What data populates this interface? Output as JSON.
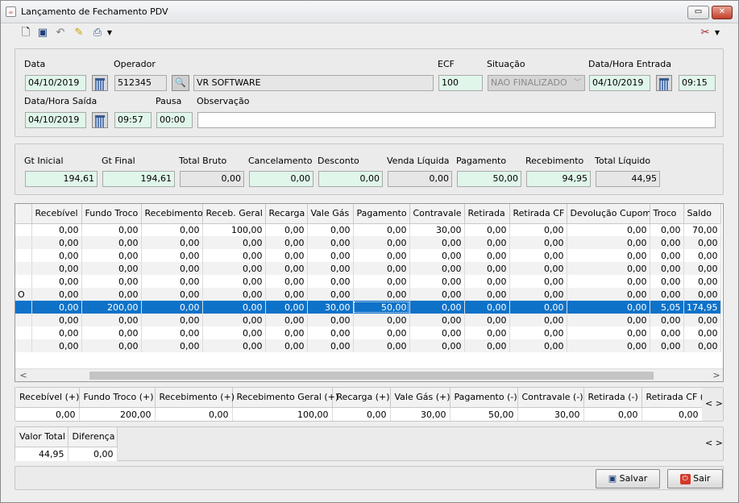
{
  "window": {
    "title": "Lançamento de Fechamento PDV"
  },
  "toolbar": {
    "icons": [
      "new-document-icon",
      "save-icon",
      "undo-icon",
      "magic-wand-icon",
      "print-icon",
      "tools-icon"
    ]
  },
  "header": {
    "data_label": "Data",
    "data_value": "04/10/2019",
    "operador_label": "Operador",
    "operador_code": "512345",
    "operador_name": "VR SOFTWARE",
    "ecf_label": "ECF",
    "ecf_value": "100",
    "situacao_label": "Situação",
    "situacao_value": "NAO FINALIZADO",
    "entrada_label": "Data/Hora Entrada",
    "entrada_date": "04/10/2019",
    "entrada_time": "09:15",
    "saida_label": "Data/Hora Saída",
    "saida_date": "04/10/2019",
    "saida_time": "09:57",
    "pausa_label": "Pausa",
    "pausa_value": "00:00",
    "observacao_label": "Observação",
    "observacao_value": ""
  },
  "totals": [
    {
      "label": "Gt Inicial",
      "value": "194,61"
    },
    {
      "label": "Gt Final",
      "value": "194,61"
    },
    {
      "label": "Total Bruto",
      "value": "0,00"
    },
    {
      "label": "Cancelamento",
      "value": "0,00"
    },
    {
      "label": "Desconto",
      "value": "0,00"
    },
    {
      "label": "Venda Líquida",
      "value": "0,00"
    },
    {
      "label": "Pagamento",
      "value": "50,00"
    },
    {
      "label": "Recebimento",
      "value": "94,95"
    },
    {
      "label": "Total Líquido",
      "value": "44,95"
    }
  ],
  "grid": {
    "columns": [
      "",
      "Recebível",
      "Fundo Troco",
      "Recebimento",
      "Receb. Geral",
      "Recarga",
      "Vale Gás",
      "Pagamento",
      "Contravale",
      "Retirada",
      "Retirada CF",
      "Devolução Cupom",
      "Troco",
      "Saldo"
    ],
    "rows": [
      [
        "",
        "0,00",
        "0,00",
        "0,00",
        "100,00",
        "0,00",
        "0,00",
        "0,00",
        "30,00",
        "0,00",
        "0,00",
        "0,00",
        "0,00",
        "70,00"
      ],
      [
        "",
        "0,00",
        "0,00",
        "0,00",
        "0,00",
        "0,00",
        "0,00",
        "0,00",
        "0,00",
        "0,00",
        "0,00",
        "0,00",
        "0,00",
        "0,00"
      ],
      [
        "",
        "0,00",
        "0,00",
        "0,00",
        "0,00",
        "0,00",
        "0,00",
        "0,00",
        "0,00",
        "0,00",
        "0,00",
        "0,00",
        "0,00",
        "0,00"
      ],
      [
        "",
        "0,00",
        "0,00",
        "0,00",
        "0,00",
        "0,00",
        "0,00",
        "0,00",
        "0,00",
        "0,00",
        "0,00",
        "0,00",
        "0,00",
        "0,00"
      ],
      [
        "",
        "0,00",
        "0,00",
        "0,00",
        "0,00",
        "0,00",
        "0,00",
        "0,00",
        "0,00",
        "0,00",
        "0,00",
        "0,00",
        "0,00",
        "0,00"
      ],
      [
        "O",
        "0,00",
        "0,00",
        "0,00",
        "0,00",
        "0,00",
        "0,00",
        "0,00",
        "0,00",
        "0,00",
        "0,00",
        "0,00",
        "0,00",
        "0,00"
      ],
      [
        "",
        "0,00",
        "200,00",
        "0,00",
        "0,00",
        "0,00",
        "30,00",
        "50,00",
        "0,00",
        "0,00",
        "0,00",
        "0,00",
        "5,05",
        "174,95"
      ],
      [
        "",
        "0,00",
        "0,00",
        "0,00",
        "0,00",
        "0,00",
        "0,00",
        "0,00",
        "0,00",
        "0,00",
        "0,00",
        "0,00",
        "0,00",
        "0,00"
      ],
      [
        "",
        "0,00",
        "0,00",
        "0,00",
        "0,00",
        "0,00",
        "0,00",
        "0,00",
        "0,00",
        "0,00",
        "0,00",
        "0,00",
        "0,00",
        "0,00"
      ],
      [
        "",
        "0,00",
        "0,00",
        "0,00",
        "0,00",
        "0,00",
        "0,00",
        "0,00",
        "0,00",
        "0,00",
        "0,00",
        "0,00",
        "0,00",
        "0,00"
      ]
    ],
    "selected_row": 6,
    "scroll_left": "<",
    "scroll_right": ">"
  },
  "summary": {
    "columns": [
      "Recebível (+)",
      "Fundo Troco (+)",
      "Recebimento (+)",
      "Recebimento Geral (+)",
      "Recarga (+)",
      "Vale Gás (+)",
      "Pagamento (-)",
      "Contravale (-)",
      "Retirada (-)",
      "Retirada CF (-)"
    ],
    "values": [
      "0,00",
      "200,00",
      "0,00",
      "100,00",
      "0,00",
      "30,00",
      "50,00",
      "30,00",
      "0,00",
      "0,00"
    ],
    "nav": "<  >"
  },
  "final": {
    "columns": [
      "Valor Total",
      "Diferença"
    ],
    "values": [
      "44,95",
      "0,00"
    ],
    "nav": "<  >"
  },
  "footer": {
    "save_label": "Salvar",
    "exit_label": "Sair"
  }
}
